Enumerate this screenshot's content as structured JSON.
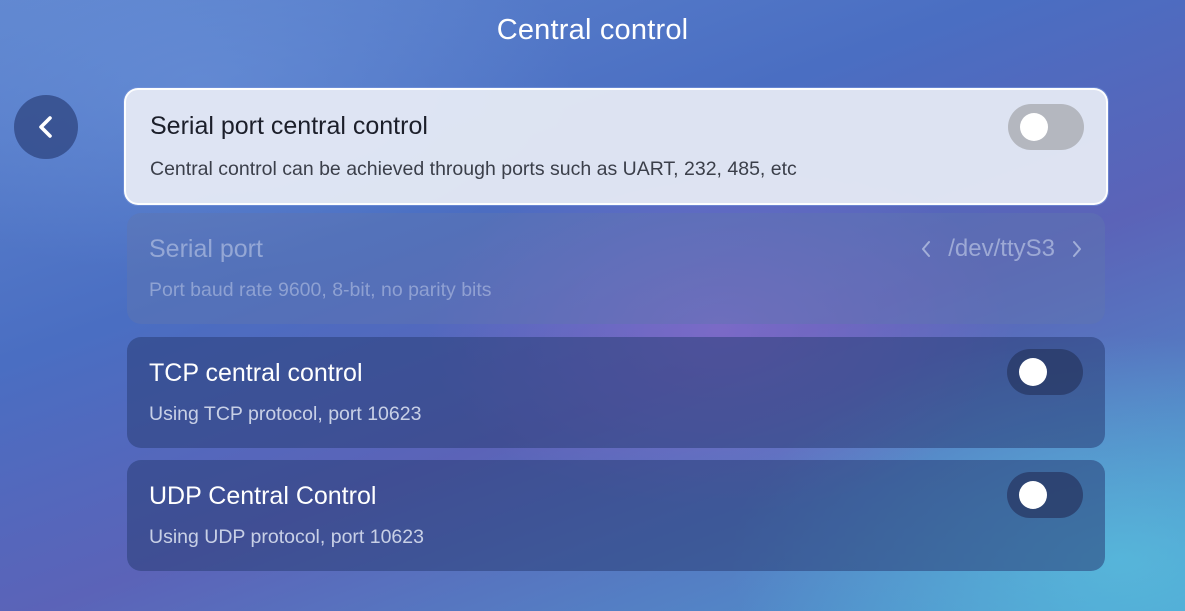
{
  "page": {
    "title": "Central control"
  },
  "settings": [
    {
      "id": "serial-central",
      "title": "Serial port central control",
      "description": "Central control can be achieved through ports such as UART, 232, 485, etc",
      "toggle_on": false
    },
    {
      "id": "serial-port",
      "title": "Serial port",
      "description": "Port baud rate 9600, 8-bit, no parity bits",
      "value": "/dev/ttyS3"
    },
    {
      "id": "tcp-central",
      "title": "TCP central control",
      "description": "Using TCP protocol, port 10623",
      "toggle_on": false
    },
    {
      "id": "udp-central",
      "title": "UDP Central Control",
      "description": "Using UDP protocol, port 10623",
      "toggle_on": false
    }
  ],
  "icons": {
    "back": "chevron-left-icon",
    "prev": "chevron-left-icon",
    "next": "chevron-right-icon"
  },
  "colors": {
    "selected_card": "#e2e7f4",
    "dark_card": "#2a3e76",
    "toggle_off_selected": "#b4b7bf",
    "knob": "#ffffff"
  }
}
